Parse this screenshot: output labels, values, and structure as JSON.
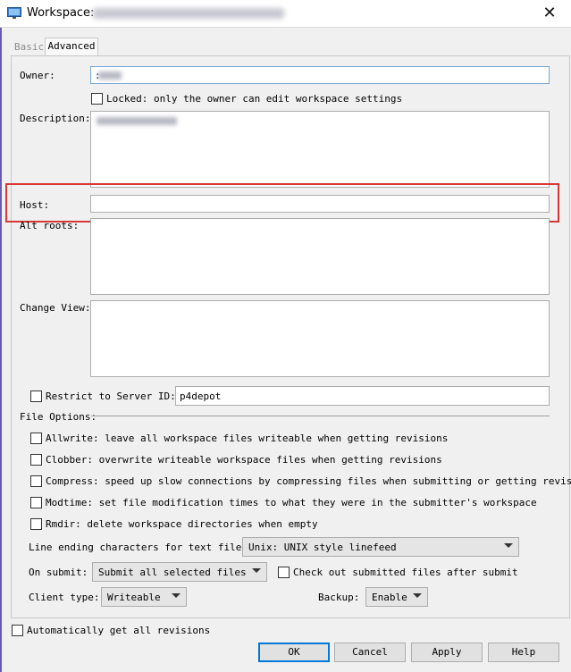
{
  "window": {
    "title": "Workspace:",
    "close_symbol": "✕",
    "icon": "monitor-icon"
  },
  "tabs": [
    {
      "label": "Basic"
    },
    {
      "label": "Advanced"
    }
  ],
  "form": {
    "owner_label": "Owner:",
    "owner_value": ":",
    "locked_label": "Locked: only the owner can edit workspace settings",
    "description_label": "Description:",
    "host_label": "Host:",
    "host_value": "",
    "alt_roots_label": "Alt roots:",
    "change_view_label": "Change View:",
    "restrict_label": "Restrict to Server ID:",
    "server_id_value": "p4depot",
    "file_options_label": "File Options:",
    "file_options": [
      {
        "label": "Allwrite: leave all workspace files writeable when getting revisions"
      },
      {
        "label": "Clobber: overwrite writeable workspace files when getting revisions"
      },
      {
        "label": "Compress: speed up slow connections by compressing files when submitting or getting revisions"
      },
      {
        "label": "Modtime: set file modification times to what they were in the submitter's workspace"
      },
      {
        "label": "Rmdir: delete workspace directories when empty"
      }
    ],
    "line_ending_label": "Line ending characters for text files:",
    "line_ending_value": "Unix: UNIX style linefeed",
    "on_submit_label": "On submit:",
    "on_submit_value": "Submit all selected files",
    "checkout_label": "Check out submitted files after submit",
    "client_type_label": "Client type:",
    "client_type_value": "Writeable",
    "backup_label": "Backup:",
    "backup_value": "Enable",
    "auto_get_label": "Automatically get all revisions"
  },
  "buttons": {
    "ok": "OK",
    "cancel": "Cancel",
    "apply": "Apply",
    "help": "Help"
  },
  "colors": {
    "highlight": "#d93636",
    "default_button_border": "#0078d7"
  }
}
